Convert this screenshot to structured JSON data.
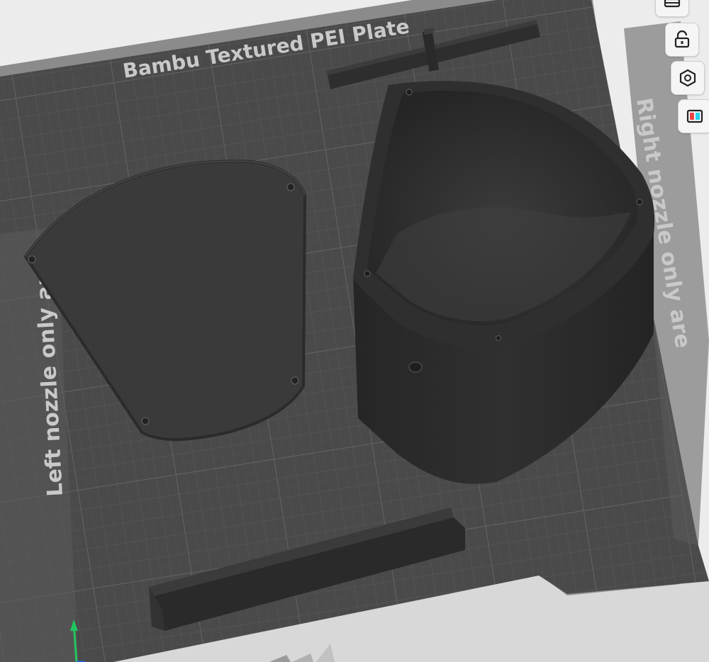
{
  "plate": {
    "name": "Bambu Textured PEI Plate",
    "left_area_label": "Left nozzle only are",
    "right_area_label": "Right nozzle only are"
  },
  "objects": [
    {
      "name": "lid",
      "color": "#3a3a3a"
    },
    {
      "name": "enclosure-body",
      "color": "#2b2b2b"
    },
    {
      "name": "top-bracket",
      "color": "#333333"
    },
    {
      "name": "bottom-rail",
      "color": "#2d2d2d"
    }
  ],
  "toolbar": {
    "items": [
      {
        "name": "layout",
        "icon": "arrange-icon"
      },
      {
        "name": "lock",
        "icon": "lock-icon"
      },
      {
        "name": "orient",
        "icon": "hex-nut-icon"
      },
      {
        "name": "color",
        "icon": "color-paint-icon"
      }
    ]
  },
  "colors": {
    "plate": "#4a4a4a",
    "grid": "#5e5e5e",
    "border_strip": "#8c8c8c",
    "background": "#ececec",
    "axis_green": "#22c55e",
    "axis_blue": "#2563eb"
  }
}
